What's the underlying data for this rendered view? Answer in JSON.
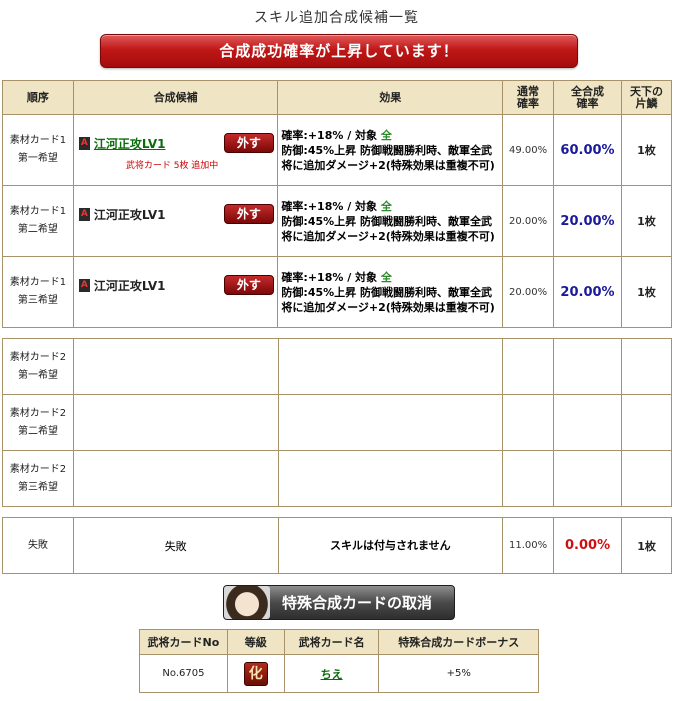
{
  "page_title": "スキル追加合成候補一覧",
  "banner": "合成成功確率が上昇しています！",
  "headers": {
    "order": "順序",
    "candidate": "合成候補",
    "effect": "効果",
    "normal_rate": "通常確率",
    "total_rate": "全合成確率",
    "tenka": "天下の片鱗"
  },
  "rows": [
    {
      "order_line1": "素材カード1",
      "order_line2": "第一希望",
      "badge": "A",
      "skill": "江河正攻LV1",
      "remove": "外す",
      "note": "武将カード 5枚 追加中",
      "effect_prefix": "確率:+18% / 対象",
      "effect_target": "全",
      "effect_rest": "防御:45%上昇 防御戦闘勝利時、敵軍全武将に追加ダメージ+2(特殊効果は重複不可)",
      "normal_rate": "49.00%",
      "total_rate": "60.00%",
      "tenka": "1枚"
    },
    {
      "order_line1": "素材カード1",
      "order_line2": "第二希望",
      "badge": "A",
      "skill": "江河正攻LV1",
      "remove": "外す",
      "effect_prefix": "確率:+18% / 対象",
      "effect_target": "全",
      "effect_rest": "防御:45%上昇 防御戦闘勝利時、敵軍全武将に追加ダメージ+2(特殊効果は重複不可)",
      "normal_rate": "20.00%",
      "total_rate": "20.00%",
      "tenka": "1枚"
    },
    {
      "order_line1": "素材カード1",
      "order_line2": "第三希望",
      "badge": "A",
      "skill": "江河正攻LV1",
      "remove": "外す",
      "effect_prefix": "確率:+18% / 対象",
      "effect_target": "全",
      "effect_rest": "防御:45%上昇 防御戦闘勝利時、敵軍全武将に追加ダメージ+2(特殊効果は重複不可)",
      "normal_rate": "20.00%",
      "total_rate": "20.00%",
      "tenka": "1枚"
    }
  ],
  "rows2": [
    {
      "order_line1": "素材カード2",
      "order_line2": "第一希望"
    },
    {
      "order_line1": "素材カード2",
      "order_line2": "第二希望"
    },
    {
      "order_line1": "素材カード2",
      "order_line2": "第三希望"
    }
  ],
  "fail_row": {
    "order": "失敗",
    "candidate": "失敗",
    "effect": "スキルは付与されません",
    "normal_rate": "11.00%",
    "total_rate": "0.00%",
    "tenka": "1枚"
  },
  "cancel_button": "特殊合成カードの取消",
  "card_table": {
    "headers": [
      "武将カードNo",
      "等級",
      "武将カード名",
      "特殊合成カードボーナス"
    ],
    "no": "No.6705",
    "rank": "化",
    "name": "ちえ",
    "bonus": "+5%"
  }
}
